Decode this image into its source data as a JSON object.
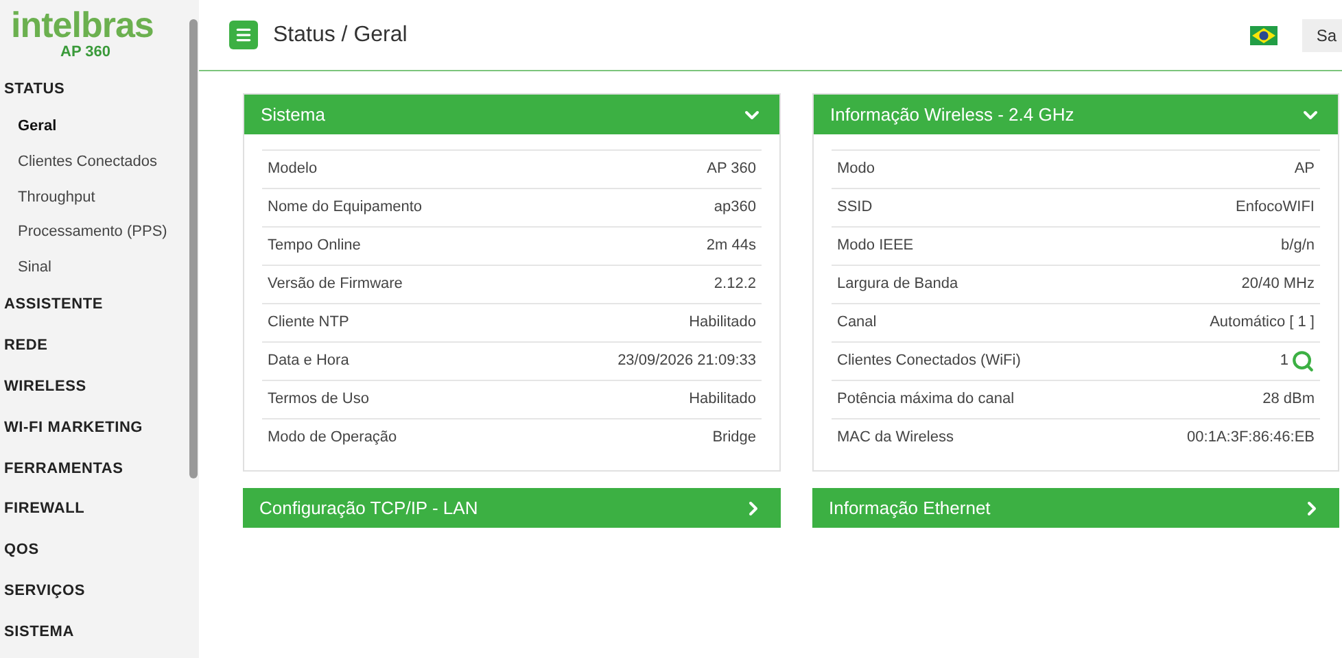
{
  "logo": {
    "brand": "intelbras",
    "model": "AP 360"
  },
  "sidebar": {
    "items": [
      {
        "label": "STATUS",
        "children": [
          {
            "label": "Geral",
            "selected": true
          },
          {
            "label": "Clientes Conectados",
            "selected": false
          },
          {
            "label": "Throughput",
            "selected": false
          },
          {
            "label": "Processamento (PPS)",
            "selected": false
          },
          {
            "label": "Sinal",
            "selected": false
          }
        ]
      },
      {
        "label": "ASSISTENTE"
      },
      {
        "label": "REDE"
      },
      {
        "label": "WIRELESS"
      },
      {
        "label": "WI-FI MARKETING"
      },
      {
        "label": "FERRAMENTAS"
      },
      {
        "label": "FIREWALL"
      },
      {
        "label": "QOS"
      },
      {
        "label": "SERVIÇOS"
      },
      {
        "label": "SISTEMA"
      }
    ]
  },
  "header": {
    "title": "Status / Geral",
    "button": "Sa"
  },
  "panels": [
    {
      "title": "Sistema",
      "expanded": true,
      "rows": [
        {
          "label": "Modelo",
          "value": "AP 360"
        },
        {
          "label": "Nome do Equipamento",
          "value": "ap360"
        },
        {
          "label": "Tempo Online",
          "value": "2m 44s"
        },
        {
          "label": "Versão de Firmware",
          "value": "2.12.2"
        },
        {
          "label": "Cliente NTP",
          "value": "Habilitado"
        },
        {
          "label": "Data e Hora",
          "value": "23/09/2026 21:09:33"
        },
        {
          "label": "Termos de Uso",
          "value": "Habilitado"
        },
        {
          "label": "Modo de Operação",
          "value": "Bridge"
        }
      ]
    },
    {
      "title": "Informação Wireless - 2.4 GHz",
      "expanded": true,
      "rows": [
        {
          "label": "Modo",
          "value": "AP"
        },
        {
          "label": "SSID",
          "value": "EnfocoWIFI"
        },
        {
          "label": "Modo IEEE",
          "value": "b/g/n"
        },
        {
          "label": "Largura de Banda",
          "value": "20/40 MHz"
        },
        {
          "label": "Canal",
          "value": "Automático [ 1 ]"
        },
        {
          "label": "Clientes Conectados (WiFi)",
          "value": "1",
          "kind": "search"
        },
        {
          "label": "Potência máxima do canal",
          "value": "28 dBm"
        },
        {
          "label": "MAC da Wireless",
          "value": "00:1A:3F:86:46:EB"
        }
      ]
    },
    {
      "title": "Configuração TCP/IP - LAN",
      "expanded": false
    },
    {
      "title": "Informação Ethernet",
      "expanded": false
    }
  ]
}
